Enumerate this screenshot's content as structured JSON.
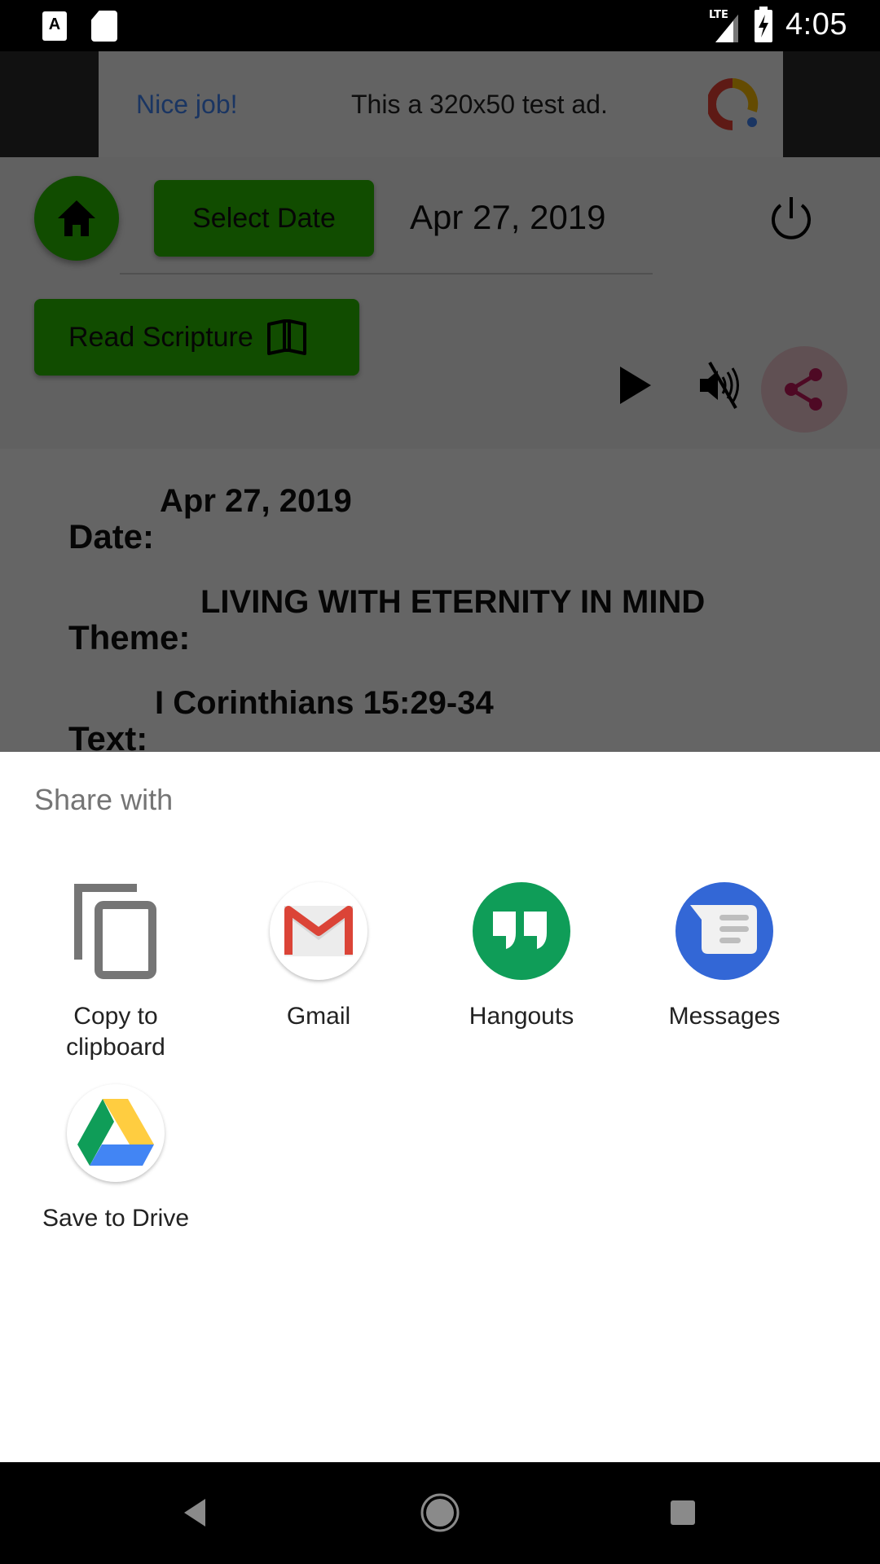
{
  "status_bar": {
    "left_icons": [
      "a-notification-icon",
      "sd-card-icon"
    ],
    "network": "LTE",
    "time": "4:05"
  },
  "ad": {
    "headline": "Nice job!",
    "text": "This a 320x50 test ad."
  },
  "toolbar": {
    "select_date_label": "Select Date",
    "current_date": "Apr 27, 2019",
    "read_scripture_label": "Read Scripture"
  },
  "details": {
    "date_label": "Date:",
    "date_value": "Apr 27, 2019",
    "theme_label": "Theme:",
    "theme_value": "LIVING WITH ETERNITY IN MIND",
    "text_label": "Text:",
    "text_value": "I Corinthians 15:29-34"
  },
  "share_sheet": {
    "title": "Share with",
    "targets": [
      {
        "label": "Copy to clipboard",
        "icon": "copy-icon"
      },
      {
        "label": "Gmail",
        "icon": "gmail-icon"
      },
      {
        "label": "Hangouts",
        "icon": "hangouts-icon"
      },
      {
        "label": "Messages",
        "icon": "messages-icon"
      },
      {
        "label": "Save to Drive",
        "icon": "drive-icon"
      }
    ]
  },
  "colors": {
    "accent_green": "#2bbd00",
    "share_accent": "#c2185b",
    "share_bg": "#f0c7d0",
    "hangouts_green": "#0f9d58",
    "messages_blue": "#3367d6"
  }
}
